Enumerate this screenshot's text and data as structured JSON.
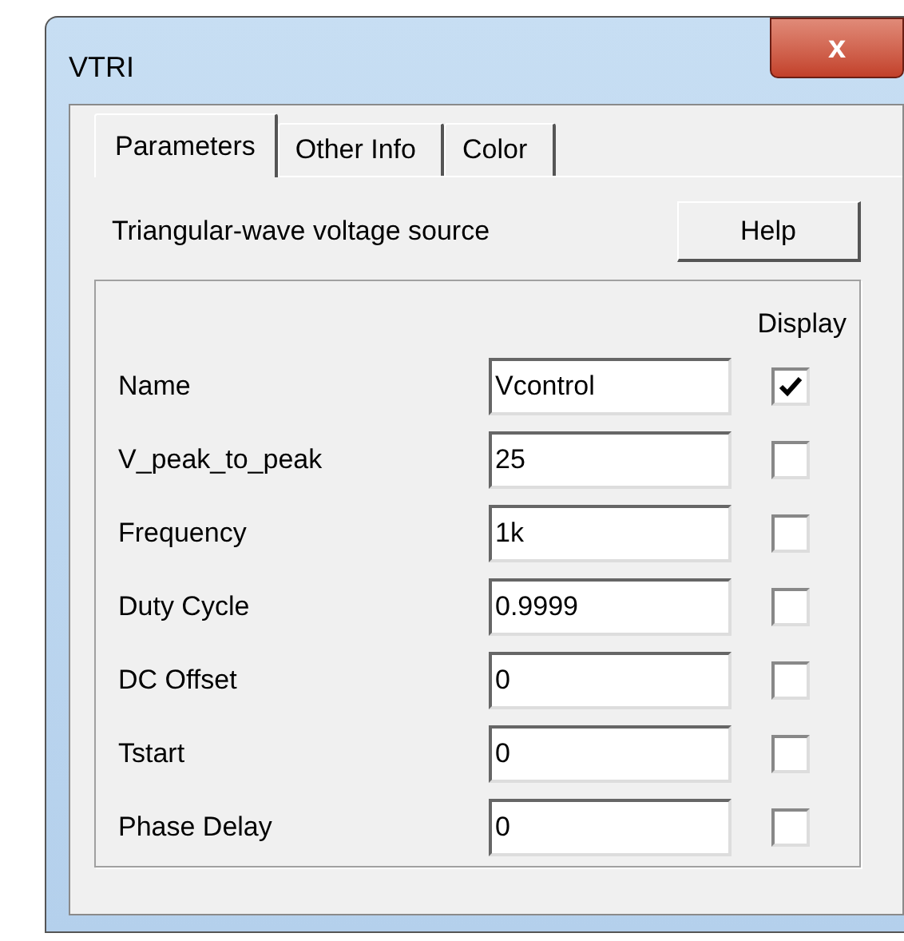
{
  "window": {
    "title": "VTRI",
    "close": "x"
  },
  "tabs": [
    {
      "label": "Parameters",
      "selected": true
    },
    {
      "label": "Other Info",
      "selected": false
    },
    {
      "label": "Color",
      "selected": false
    }
  ],
  "description": "Triangular-wave voltage source",
  "help_button": "Help",
  "display_header": "Display",
  "parameters": [
    {
      "name": "Name",
      "value": "Vcontrol",
      "display": true
    },
    {
      "name": "V_peak_to_peak",
      "value": "25",
      "display": false
    },
    {
      "name": "Frequency",
      "value": "1k",
      "display": false
    },
    {
      "name": "Duty Cycle",
      "value": "0.9999",
      "display": false
    },
    {
      "name": "DC Offset",
      "value": "0",
      "display": false
    },
    {
      "name": "Tstart",
      "value": "0",
      "display": false
    },
    {
      "name": "Phase Delay",
      "value": "0",
      "display": false
    }
  ]
}
